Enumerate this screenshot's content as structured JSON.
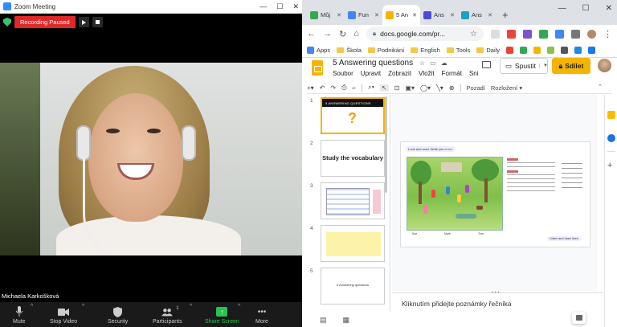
{
  "zoom": {
    "title": "Zoom Meeting",
    "recording_label": "Recording Paused",
    "participant_name": "Michaela Karkošková",
    "toolbar": {
      "mute": "Mute",
      "stop_video": "Stop Video",
      "security": "Security",
      "participants": "Participants",
      "participants_count": "1",
      "share_screen": "Share Screen",
      "more": "More"
    }
  },
  "chrome": {
    "tabs": [
      {
        "label": "Můj",
        "favicon_color": "#34a853"
      },
      {
        "label": "Fun",
        "favicon_color": "#4285f4"
      },
      {
        "label": "5 An",
        "favicon_color": "#f4b400"
      },
      {
        "label": "Ans",
        "favicon_color": "#4a4ad6"
      },
      {
        "label": "Ans",
        "favicon_color": "#1ba1c7"
      }
    ],
    "url": "docs.google.com/pr...",
    "bookmarks": [
      "Apps",
      "Škola",
      "Podnikání",
      "English",
      "Tools",
      "Daily"
    ]
  },
  "slides": {
    "title": "5 Answering questions",
    "menu": [
      "Soubor",
      "Upravit",
      "Zobrazit",
      "Vložit",
      "Formát",
      "Sni"
    ],
    "present_label": "Spustit",
    "share_label": "Sdílet",
    "toolbar": {
      "background": "Pozadí",
      "layout": "Rozložení"
    },
    "thumbnails": [
      {
        "num": "1",
        "title": "5 ANSWERING QUESTIONS"
      },
      {
        "num": "2",
        "title": "Study the vocabulary"
      },
      {
        "num": "3",
        "title": ""
      },
      {
        "num": "4",
        "title": ""
      },
      {
        "num": "5",
        "title": "5 Answering questions"
      }
    ],
    "slide": {
      "header": "Look and read. Write yes or no.",
      "footer": "Listen and draw lines.",
      "names": [
        "Sue",
        "Mark",
        "Tom"
      ]
    },
    "notes_placeholder": "Kliknutím přidejte poznámky řečníka"
  }
}
